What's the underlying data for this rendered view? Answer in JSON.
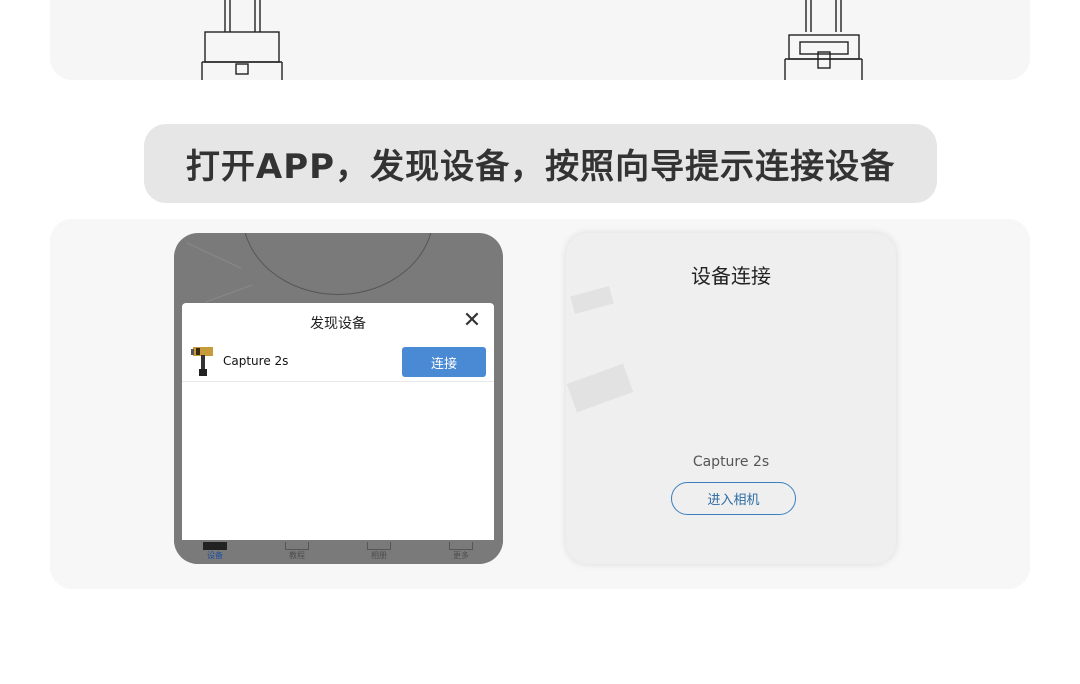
{
  "instruction": {
    "text": "打开APP，发现设备，按照向导提示连接设备"
  },
  "left_phone": {
    "dialog": {
      "title": "发现设备",
      "close_glyph": "✕",
      "device_name": "Capture 2s",
      "connect_label": "连接"
    },
    "nav": [
      {
        "label": "设备",
        "icon": "device-icon",
        "active": true
      },
      {
        "label": "教程",
        "icon": "tutorial-icon",
        "active": false
      },
      {
        "label": "相册",
        "icon": "album-icon",
        "active": false
      },
      {
        "label": "更多",
        "icon": "more-icon",
        "active": false
      }
    ]
  },
  "right_phone": {
    "title": "设备连接",
    "device_name": "Capture 2s",
    "enter_camera_label": "进入相机"
  },
  "colors": {
    "accent_blue": "#4a8ad4",
    "outline_blue": "#3a7fbf",
    "active_nav": "#1f4f9e",
    "pill_bg": "#e6e6e6"
  }
}
